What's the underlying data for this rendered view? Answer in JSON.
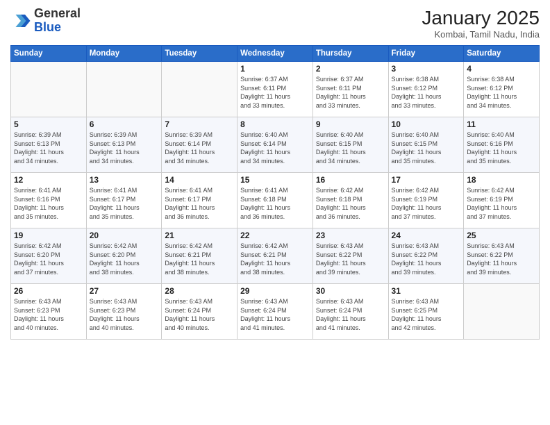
{
  "header": {
    "logo_general": "General",
    "logo_blue": "Blue",
    "month_title": "January 2025",
    "subtitle": "Kombai, Tamil Nadu, India"
  },
  "days_of_week": [
    "Sunday",
    "Monday",
    "Tuesday",
    "Wednesday",
    "Thursday",
    "Friday",
    "Saturday"
  ],
  "weeks": [
    [
      {
        "day": "",
        "info": ""
      },
      {
        "day": "",
        "info": ""
      },
      {
        "day": "",
        "info": ""
      },
      {
        "day": "1",
        "info": "Sunrise: 6:37 AM\nSunset: 6:11 PM\nDaylight: 11 hours\nand 33 minutes."
      },
      {
        "day": "2",
        "info": "Sunrise: 6:37 AM\nSunset: 6:11 PM\nDaylight: 11 hours\nand 33 minutes."
      },
      {
        "day": "3",
        "info": "Sunrise: 6:38 AM\nSunset: 6:12 PM\nDaylight: 11 hours\nand 33 minutes."
      },
      {
        "day": "4",
        "info": "Sunrise: 6:38 AM\nSunset: 6:12 PM\nDaylight: 11 hours\nand 34 minutes."
      }
    ],
    [
      {
        "day": "5",
        "info": "Sunrise: 6:39 AM\nSunset: 6:13 PM\nDaylight: 11 hours\nand 34 minutes."
      },
      {
        "day": "6",
        "info": "Sunrise: 6:39 AM\nSunset: 6:13 PM\nDaylight: 11 hours\nand 34 minutes."
      },
      {
        "day": "7",
        "info": "Sunrise: 6:39 AM\nSunset: 6:14 PM\nDaylight: 11 hours\nand 34 minutes."
      },
      {
        "day": "8",
        "info": "Sunrise: 6:40 AM\nSunset: 6:14 PM\nDaylight: 11 hours\nand 34 minutes."
      },
      {
        "day": "9",
        "info": "Sunrise: 6:40 AM\nSunset: 6:15 PM\nDaylight: 11 hours\nand 34 minutes."
      },
      {
        "day": "10",
        "info": "Sunrise: 6:40 AM\nSunset: 6:15 PM\nDaylight: 11 hours\nand 35 minutes."
      },
      {
        "day": "11",
        "info": "Sunrise: 6:40 AM\nSunset: 6:16 PM\nDaylight: 11 hours\nand 35 minutes."
      }
    ],
    [
      {
        "day": "12",
        "info": "Sunrise: 6:41 AM\nSunset: 6:16 PM\nDaylight: 11 hours\nand 35 minutes."
      },
      {
        "day": "13",
        "info": "Sunrise: 6:41 AM\nSunset: 6:17 PM\nDaylight: 11 hours\nand 35 minutes."
      },
      {
        "day": "14",
        "info": "Sunrise: 6:41 AM\nSunset: 6:17 PM\nDaylight: 11 hours\nand 36 minutes."
      },
      {
        "day": "15",
        "info": "Sunrise: 6:41 AM\nSunset: 6:18 PM\nDaylight: 11 hours\nand 36 minutes."
      },
      {
        "day": "16",
        "info": "Sunrise: 6:42 AM\nSunset: 6:18 PM\nDaylight: 11 hours\nand 36 minutes."
      },
      {
        "day": "17",
        "info": "Sunrise: 6:42 AM\nSunset: 6:19 PM\nDaylight: 11 hours\nand 37 minutes."
      },
      {
        "day": "18",
        "info": "Sunrise: 6:42 AM\nSunset: 6:19 PM\nDaylight: 11 hours\nand 37 minutes."
      }
    ],
    [
      {
        "day": "19",
        "info": "Sunrise: 6:42 AM\nSunset: 6:20 PM\nDaylight: 11 hours\nand 37 minutes."
      },
      {
        "day": "20",
        "info": "Sunrise: 6:42 AM\nSunset: 6:20 PM\nDaylight: 11 hours\nand 38 minutes."
      },
      {
        "day": "21",
        "info": "Sunrise: 6:42 AM\nSunset: 6:21 PM\nDaylight: 11 hours\nand 38 minutes."
      },
      {
        "day": "22",
        "info": "Sunrise: 6:42 AM\nSunset: 6:21 PM\nDaylight: 11 hours\nand 38 minutes."
      },
      {
        "day": "23",
        "info": "Sunrise: 6:43 AM\nSunset: 6:22 PM\nDaylight: 11 hours\nand 39 minutes."
      },
      {
        "day": "24",
        "info": "Sunrise: 6:43 AM\nSunset: 6:22 PM\nDaylight: 11 hours\nand 39 minutes."
      },
      {
        "day": "25",
        "info": "Sunrise: 6:43 AM\nSunset: 6:22 PM\nDaylight: 11 hours\nand 39 minutes."
      }
    ],
    [
      {
        "day": "26",
        "info": "Sunrise: 6:43 AM\nSunset: 6:23 PM\nDaylight: 11 hours\nand 40 minutes."
      },
      {
        "day": "27",
        "info": "Sunrise: 6:43 AM\nSunset: 6:23 PM\nDaylight: 11 hours\nand 40 minutes."
      },
      {
        "day": "28",
        "info": "Sunrise: 6:43 AM\nSunset: 6:24 PM\nDaylight: 11 hours\nand 40 minutes."
      },
      {
        "day": "29",
        "info": "Sunrise: 6:43 AM\nSunset: 6:24 PM\nDaylight: 11 hours\nand 41 minutes."
      },
      {
        "day": "30",
        "info": "Sunrise: 6:43 AM\nSunset: 6:24 PM\nDaylight: 11 hours\nand 41 minutes."
      },
      {
        "day": "31",
        "info": "Sunrise: 6:43 AM\nSunset: 6:25 PM\nDaylight: 11 hours\nand 42 minutes."
      },
      {
        "day": "",
        "info": ""
      }
    ]
  ]
}
